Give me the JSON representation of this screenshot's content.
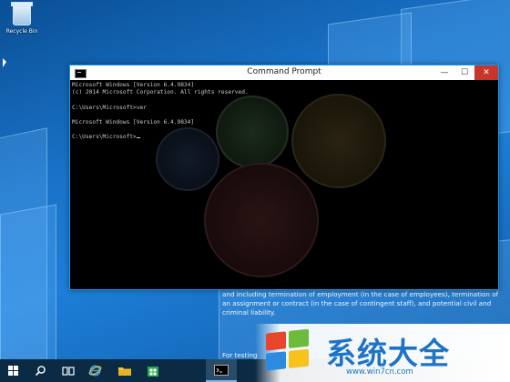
{
  "desktop": {
    "recycle_bin_label": "Recycle Bin"
  },
  "window": {
    "title": "Command Prompt",
    "minimize_glyph": "—",
    "maximize_glyph": "☐",
    "close_glyph": "✕"
  },
  "console": {
    "lines": [
      "Microsoft Windows [Version 6.4.9834]",
      "(c) 2014 Microsoft Corporation. All rights reserved.",
      "",
      "C:\\Users\\Microsoft>ver",
      "",
      "Microsoft Windows [Version 6.4.9834]",
      "",
      "C:\\Users\\Microsoft>"
    ]
  },
  "background_text": {
    "paragraph": "and including termination of employment (in the case of employees), termination of an assignment or contract (in the case of contingent staff), and potential civil and criminal liability.",
    "footer": "For testing"
  },
  "taskbar": {
    "items": [
      "start",
      "search",
      "task-view",
      "internet-explorer",
      "file-explorer",
      "store",
      "command-prompt"
    ]
  },
  "watermark": {
    "brand": "系统大全",
    "url": "www.win7cn.com"
  },
  "colors": {
    "titlebar_close": "#c7362a",
    "console_bg": "#000000",
    "taskbar_bg": "#0b2a44",
    "watermark_blue": "#1d74c6"
  }
}
